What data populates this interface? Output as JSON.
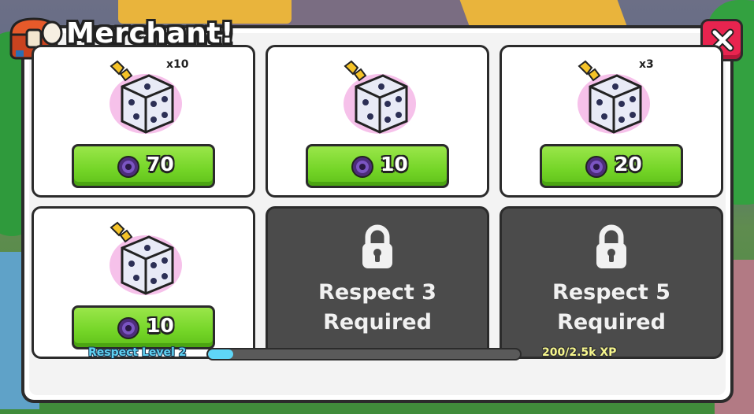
{
  "window": {
    "title": "Merchant!"
  },
  "items": [
    {
      "multiplier": "x10",
      "price": "70",
      "currency_icon": "purple-coin-icon"
    },
    {
      "multiplier": "",
      "price": "10",
      "currency_icon": "purple-coin-icon"
    },
    {
      "multiplier": "x3",
      "price": "20",
      "currency_icon": "purple-coin-icon"
    },
    {
      "multiplier": "",
      "price": "10",
      "currency_icon": "purple-coin-icon"
    }
  ],
  "locked_slots": [
    {
      "line1": "Respect 3",
      "line2": "Required",
      "icon": "lock-icon"
    },
    {
      "line1": "Respect 5",
      "line2": "Required",
      "icon": "lock-icon"
    }
  ],
  "footer": {
    "level_label": "Respect Level 2",
    "xp_label": "200/2.5k XP",
    "progress_fraction": 0.08
  },
  "colors": {
    "close": "#e8244f",
    "buy": "#74d527",
    "locked": "#4b4b4b",
    "progress": "#5fd6f7"
  }
}
